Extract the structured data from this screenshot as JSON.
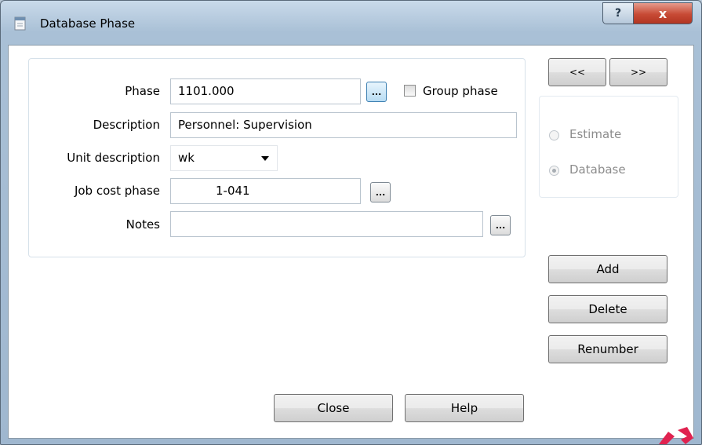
{
  "window": {
    "title": "Database Phase",
    "help_glyph": "?",
    "close_glyph": "x",
    "icon": "document-icon"
  },
  "form": {
    "phase_label": "Phase",
    "phase_value": "1101.000",
    "group_phase_label": "Group phase",
    "group_phase_checked": false,
    "description_label": "Description",
    "description_value": "Personnel: Supervision",
    "unit_label": "Unit description",
    "unit_value": "wk",
    "job_cost_label": "Job cost phase",
    "job_cost_value": "1-041",
    "notes_label": "Notes",
    "notes_value": "",
    "ellipsis": "..."
  },
  "nav": {
    "prev": "<<",
    "next": ">>"
  },
  "mode": {
    "estimate": "Estimate",
    "database": "Database",
    "selected": "Database"
  },
  "actions": {
    "add": "Add",
    "delete": "Delete",
    "renumber": "Renumber",
    "close": "Close",
    "help": "Help"
  },
  "colors": {
    "accent": "#3c7fb1",
    "close_red": "#c74a35",
    "logo": "#e0224f"
  }
}
